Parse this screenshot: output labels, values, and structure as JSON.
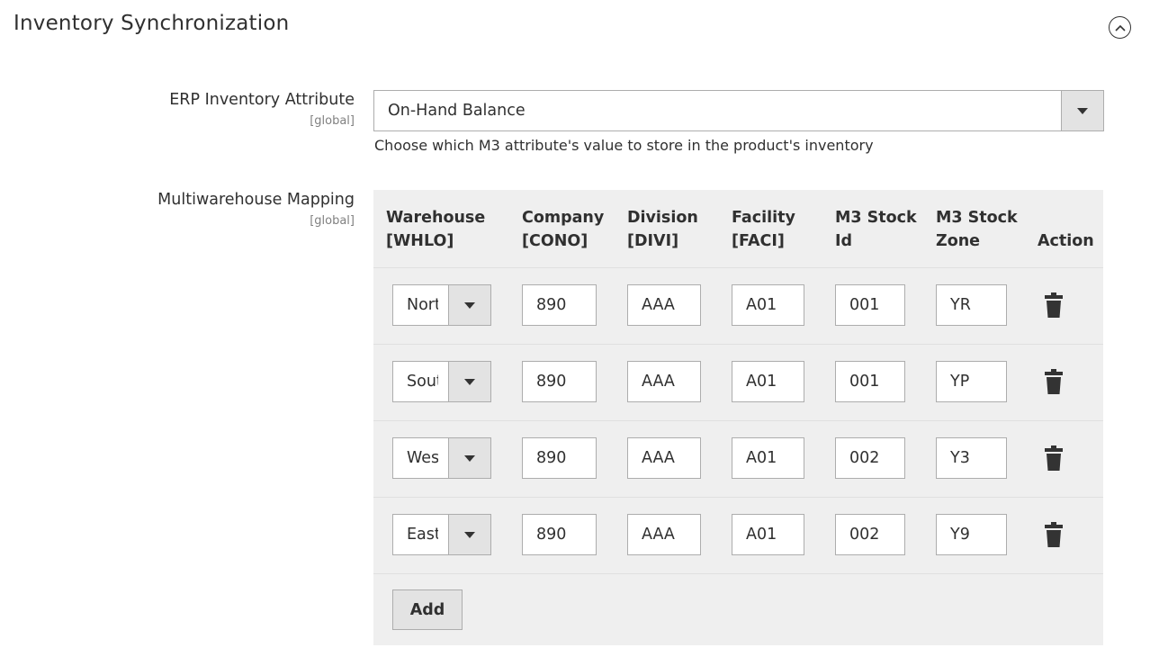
{
  "section": {
    "title": "Inventory Synchronization"
  },
  "erp_attribute": {
    "label": "ERP Inventory Attribute",
    "scope": "[global]",
    "selected": "On-Hand Balance",
    "note": "Choose which M3 attribute's value to store in the product's inventory"
  },
  "mapping": {
    "label": "Multiwarehouse Mapping",
    "scope": "[global]",
    "columns": [
      {
        "line1": "Warehouse",
        "line2": "[WHLO]"
      },
      {
        "line1": "Company",
        "line2": "[CONO]"
      },
      {
        "line1": "Division",
        "line2": "[DIVI]"
      },
      {
        "line1": "Facility",
        "line2": "[FACI]"
      },
      {
        "line1": "M3 Stock",
        "line2": "Id"
      },
      {
        "line1": "M3 Stock",
        "line2": "Zone"
      },
      {
        "line1": "",
        "line2": "Action"
      }
    ],
    "rows": [
      {
        "warehouse": "North",
        "company": "890",
        "division": "AAA",
        "facility": "A01",
        "stock_id": "001",
        "stock_zone": "YR"
      },
      {
        "warehouse": "South",
        "company": "890",
        "division": "AAA",
        "facility": "A01",
        "stock_id": "001",
        "stock_zone": "YP"
      },
      {
        "warehouse": "West",
        "company": "890",
        "division": "AAA",
        "facility": "A01",
        "stock_id": "002",
        "stock_zone": "Y3"
      },
      {
        "warehouse": "East",
        "company": "890",
        "division": "AAA",
        "facility": "A01",
        "stock_id": "002",
        "stock_zone": "Y9"
      }
    ],
    "add_label": "Add"
  },
  "icons": {
    "collapse": "chevron-up-circle-icon",
    "dropdown": "caret-down-icon",
    "delete": "trash-icon"
  }
}
